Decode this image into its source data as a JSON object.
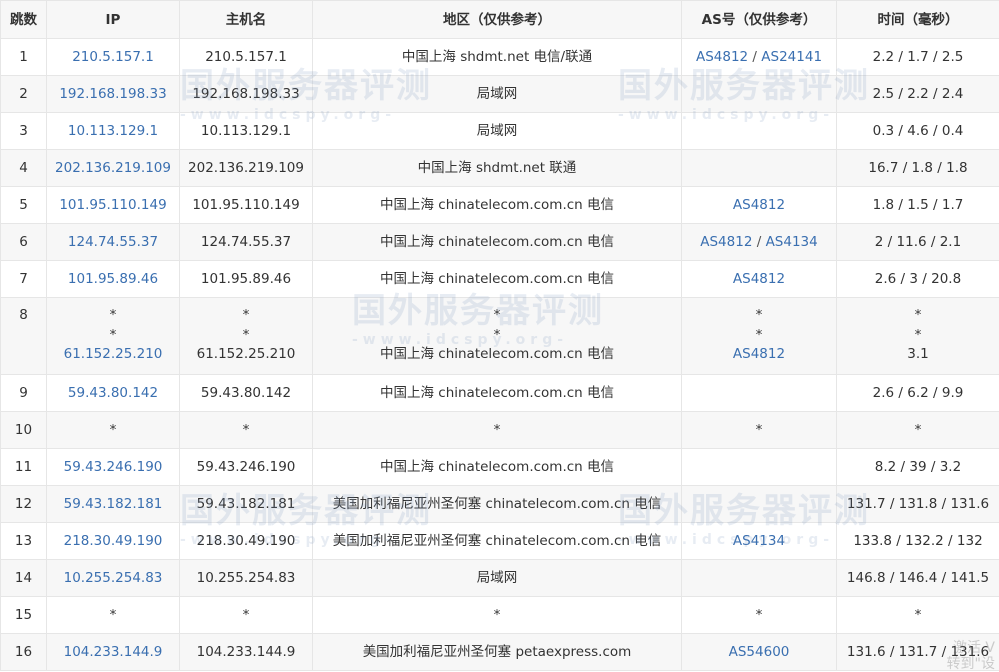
{
  "headers": {
    "hop": "跳数",
    "ip": "IP",
    "host": "主机名",
    "region": "地区（仅供参考）",
    "as": "AS号（仅供参考）",
    "time": "时间（毫秒）"
  },
  "rows": [
    {
      "hop": "1",
      "ip": "210.5.157.1",
      "host": "210.5.157.1",
      "region": "中国上海 shdmt.net 电信/联通",
      "as1": "AS4812",
      "as2": "AS24141",
      "time": "2.2 / 1.7 / 2.5"
    },
    {
      "hop": "2",
      "ip": "192.168.198.33",
      "host": "192.168.198.33",
      "region": "局域网",
      "as1": "",
      "as2": "",
      "time": "2.5 / 2.2 / 2.4"
    },
    {
      "hop": "3",
      "ip": "10.113.129.1",
      "host": "10.113.129.1",
      "region": "局域网",
      "as1": "",
      "as2": "",
      "time": "0.3 / 4.6 / 0.4"
    },
    {
      "hop": "4",
      "ip": "202.136.219.109",
      "host": "202.136.219.109",
      "region": "中国上海 shdmt.net 联通",
      "as1": "",
      "as2": "",
      "time": "16.7 / 1.8 / 1.8"
    },
    {
      "hop": "5",
      "ip": "101.95.110.149",
      "host": "101.95.110.149",
      "region": "中国上海 chinatelecom.com.cn 电信",
      "as1": "AS4812",
      "as2": "",
      "time": "1.8 / 1.5 / 1.7"
    },
    {
      "hop": "6",
      "ip": "124.74.55.37",
      "host": "124.74.55.37",
      "region": "中国上海 chinatelecom.com.cn 电信",
      "as1": "AS4812",
      "as2": "AS4134",
      "time": "2 / 11.6 / 2.1"
    },
    {
      "hop": "7",
      "ip": "101.95.89.46",
      "host": "101.95.89.46",
      "region": "中国上海 chinatelecom.com.cn 电信",
      "as1": "AS4812",
      "as2": "",
      "time": "2.6 / 3 / 20.8"
    },
    {
      "hop": "8",
      "lines": [
        {
          "ip": "*",
          "host": "*",
          "region": "*",
          "as": "*",
          "time": "*"
        },
        {
          "ip": "*",
          "host": "*",
          "region": "*",
          "as": "*",
          "time": "*"
        },
        {
          "ip": "61.152.25.210",
          "host": "61.152.25.210",
          "region": "中国上海 chinatelecom.com.cn 电信",
          "as": "AS4812",
          "time": "3.1"
        }
      ]
    },
    {
      "hop": "9",
      "ip": "59.43.80.142",
      "host": "59.43.80.142",
      "region": "中国上海 chinatelecom.com.cn 电信",
      "as1": "",
      "as2": "",
      "time": "2.6 / 6.2 / 9.9"
    },
    {
      "hop": "10",
      "ip": "*",
      "host": "*",
      "region": "*",
      "as1": "*",
      "as2": "",
      "time": "*"
    },
    {
      "hop": "11",
      "ip": "59.43.246.190",
      "host": "59.43.246.190",
      "region": "中国上海 chinatelecom.com.cn 电信",
      "as1": "",
      "as2": "",
      "time": "8.2 / 39 / 3.2"
    },
    {
      "hop": "12",
      "ip": "59.43.182.181",
      "host": "59.43.182.181",
      "region": "美国加利福尼亚州圣何塞 chinatelecom.com.cn 电信",
      "as1": "",
      "as2": "",
      "time": "131.7 / 131.8 / 131.6"
    },
    {
      "hop": "13",
      "ip": "218.30.49.190",
      "host": "218.30.49.190",
      "region": "美国加利福尼亚州圣何塞 chinatelecom.com.cn 电信",
      "as1": "AS4134",
      "as2": "",
      "time": "133.8 / 132.2 / 132"
    },
    {
      "hop": "14",
      "ip": "10.255.254.83",
      "host": "10.255.254.83",
      "region": "局域网",
      "as1": "",
      "as2": "",
      "time": "146.8 / 146.4 / 141.5"
    },
    {
      "hop": "15",
      "ip": "*",
      "host": "*",
      "region": "*",
      "as1": "*",
      "as2": "",
      "time": "*"
    },
    {
      "hop": "16",
      "ip": "104.233.144.9",
      "host": "104.233.144.9",
      "region": "美国加利福尼亚州圣何塞 petaexpress.com",
      "as1": "AS54600",
      "as2": "",
      "time": "131.6 / 131.7 / 131.6"
    }
  ],
  "watermark": {
    "text": "国外服务器评测",
    "url": "-www.idcspy.org-"
  },
  "corner_text": {
    "line1": "激活 V",
    "line2": "转到\"设"
  },
  "colors": {
    "link": "#3a6fb0",
    "header_bg": "#f7f7f7",
    "stripe": "#f7f7f7",
    "border": "#e6e6e6"
  }
}
